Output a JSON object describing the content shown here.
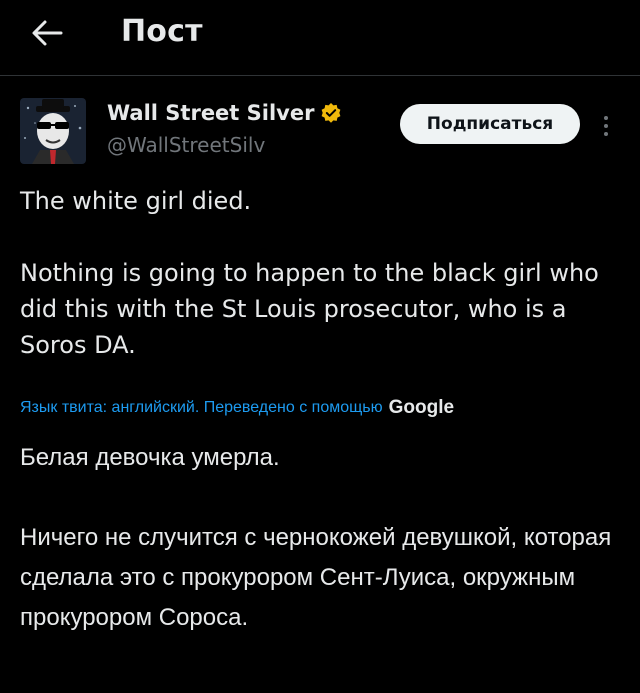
{
  "header": {
    "title": "Пост",
    "back_icon": "arrow-left-icon"
  },
  "author": {
    "name": "Wall Street Silver",
    "handle": "@WallStreetSilv",
    "verified_icon": "verified-badge-icon",
    "verified_color": "#f0b90b"
  },
  "actions": {
    "subscribe_label": "Подписаться",
    "more_icon": "more-vertical-icon"
  },
  "tweet": {
    "text": "The white girl died.\n\nNothing is going to happen to the black girl who did this with the St Louis prosecutor, who is a Soros DA."
  },
  "translation": {
    "note": "Язык твита: английский. Переведено с помощью",
    "provider": "Google",
    "text": "Белая девочка умерла.\n\nНичего не случится с чернокожей девушкой, которая сделала это с прокурором Сент-Луиса, окружным прокурором Сороса."
  },
  "colors": {
    "background": "#000000",
    "text": "#e7e9ea",
    "muted": "#71767b",
    "link": "#1d9bf0",
    "divider": "#2f3336"
  }
}
